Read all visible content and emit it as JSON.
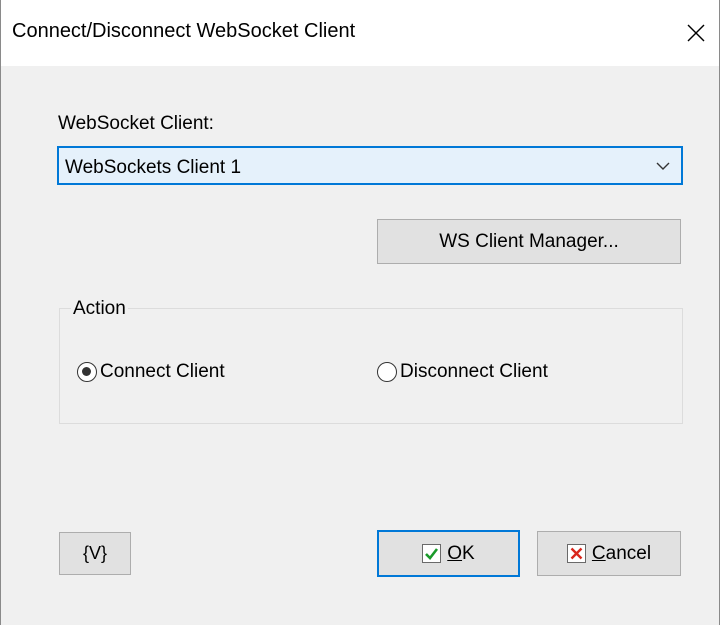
{
  "window": {
    "title": "Connect/Disconnect WebSocket Client"
  },
  "client": {
    "label": "WebSocket Client:",
    "selected": "WebSockets Client 1"
  },
  "buttons": {
    "manager": "WS Client Manager...",
    "vars": "{V}",
    "ok_label_underlined": "O",
    "ok_label_rest": "K",
    "cancel_label_underlined": "C",
    "cancel_label_rest": "ancel"
  },
  "action": {
    "group_label": "Action",
    "options": [
      {
        "label": "Connect Client",
        "checked": true
      },
      {
        "label": "Disconnect Client",
        "checked": false
      }
    ]
  },
  "colors": {
    "accent": "#0078d7",
    "ok_check": "#1a9a2a",
    "cancel_x": "#d9261c"
  },
  "icons": {
    "close": "close-icon",
    "dropdown": "chevron-down-icon",
    "ok": "checkmark-icon",
    "cancel": "x-icon"
  }
}
